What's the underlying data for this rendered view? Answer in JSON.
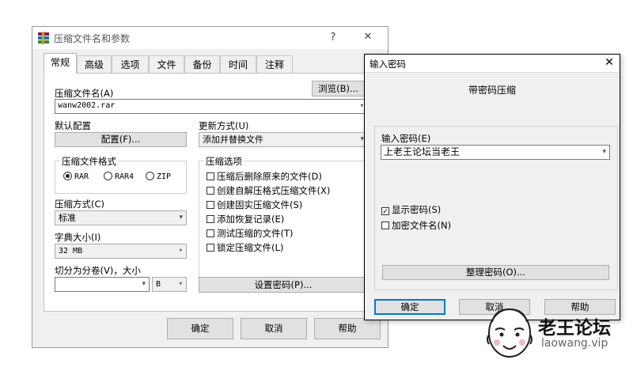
{
  "main_dialog": {
    "title": "压缩文件名和参数",
    "help_btn": "?",
    "close_btn": "✕",
    "tabs": [
      "常规",
      "高级",
      "选项",
      "文件",
      "备份",
      "时间",
      "注释"
    ],
    "archive_name_label": "压缩文件名(A)",
    "browse_button": "浏览(B)...",
    "archive_name_value": "wanw2002.rar",
    "default_profile_label": "默认配置",
    "profile_button": "配置(F)...",
    "update_mode_label": "更新方式(U)",
    "update_mode_value": "添加并替换文件",
    "format_group_label": "压缩文件格式",
    "formats": [
      "RAR",
      "RAR4",
      "ZIP"
    ],
    "selected_format": "RAR",
    "options_group_label": "压缩选项",
    "options": [
      {
        "label": "压缩后删除原来的文件(D)",
        "checked": false
      },
      {
        "label": "创建自解压格式压缩文件(X)",
        "checked": false
      },
      {
        "label": "创建固实压缩文件(S)",
        "checked": false
      },
      {
        "label": "添加恢复记录(E)",
        "checked": false
      },
      {
        "label": "测试压缩的文件(T)",
        "checked": false
      },
      {
        "label": "锁定压缩文件(L)",
        "checked": false
      }
    ],
    "method_label": "压缩方式(C)",
    "method_value": "标准",
    "dict_label": "字典大小(I)",
    "dict_value": "32 MB",
    "split_label": "切分为分卷(V)，大小",
    "split_value": "",
    "split_unit": "B",
    "set_password_button": "设置密码(P)...",
    "ok_button": "确定",
    "cancel_button": "取消",
    "help_button": "帮助"
  },
  "password_dialog": {
    "title": "输入密码",
    "close_btn": "✕",
    "heading": "带密码压缩",
    "password_label": "输入密码(E)",
    "password_value": "上老王论坛当老王",
    "show_password_label": "显示密码(S)",
    "show_password_checked": true,
    "encrypt_names_label": "加密文件名(N)",
    "encrypt_names_checked": false,
    "organize_button": "整理密码(O)...",
    "ok_button": "确定",
    "cancel_button": "取消",
    "help_button": "帮助"
  },
  "watermark": {
    "brand": "老王论坛",
    "site": "laowang.vip"
  },
  "icons": {
    "app_icon": "winrar-books-icon",
    "chevron": "▾"
  }
}
